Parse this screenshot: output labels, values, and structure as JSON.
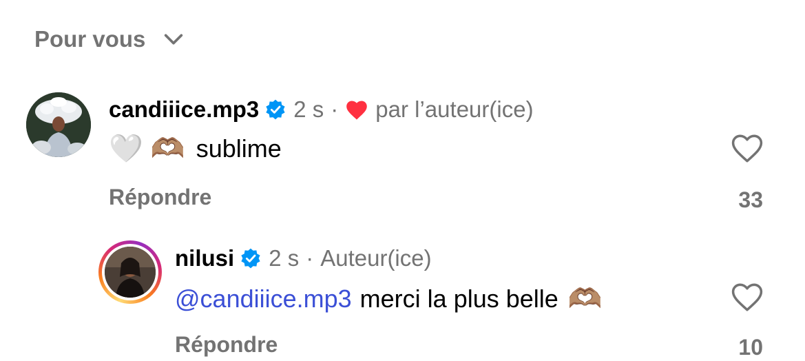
{
  "filter": {
    "label": "Pour vous"
  },
  "comments": [
    {
      "username": "candiiice.mp3",
      "time": "2 s",
      "separator": "·",
      "liked_by_author_label": "par l’auteur(ice)",
      "emojis": "🤍 🫶🏽",
      "text": "sublime",
      "reply_label": "Répondre",
      "like_count": "33"
    },
    {
      "username": "nilusi",
      "time": "2 s",
      "separator": "·",
      "author_badge": "Auteur(ice)",
      "mention": "@candiiice.mp3",
      "text": "merci la plus belle",
      "emoji": "🫶🏽",
      "reply_label": "Répondre",
      "like_count": "10"
    }
  ],
  "colors": {
    "verified": "#0095f6",
    "heart": "#ff3040",
    "mention": "#3b4fd6",
    "secondary": "#737373"
  },
  "icons": [
    "chevron-down-icon",
    "verified-badge-icon",
    "heart-filled-icon",
    "heart-outline-icon"
  ]
}
